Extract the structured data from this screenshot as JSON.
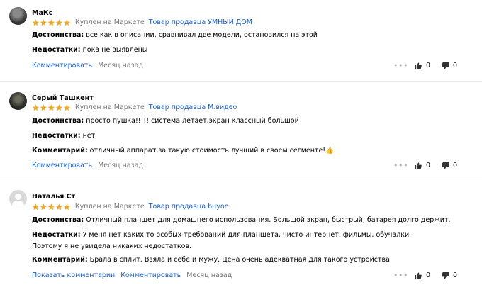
{
  "reviews": [
    {
      "author": "МаКс",
      "bought": "Куплен на Маркете",
      "seller": "Товар продавца УМНЫЙ ДОМ",
      "fields": [
        {
          "label": "Достоинства:",
          "text": "все как в описании, сравнивал две модели, остановился на этой"
        },
        {
          "label": "Недостатки:",
          "text": "пока не выявлены"
        }
      ],
      "comment_link": "Комментировать",
      "date": "Месяц назад",
      "likes": "0",
      "dislikes": "0"
    },
    {
      "author": "Серый Ташкент",
      "bought": "Куплен на Маркете",
      "seller": "Товар продавца М.видео",
      "fields": [
        {
          "label": "Достоинства:",
          "text": "просто пушка!!!!! система летает,экран классный большой"
        },
        {
          "label": "Недостатки:",
          "text": "нет"
        },
        {
          "label": "Комментарий:",
          "text": "отличный аппарат,за такую стоимость лучший в своем сегменте!👍"
        }
      ],
      "comment_link": "Комментировать",
      "date": "Месяц назад",
      "likes": "0",
      "dislikes": "0"
    },
    {
      "author": "Наталья Ст",
      "bought": "Куплен на Маркете",
      "seller": "Товар продавца buyon",
      "fields": [
        {
          "label": "Достоинства:",
          "text": "Отличный планшет для домашнего использования. Большой экран, быстрый, батарея долго держит."
        },
        {
          "label": "Недостатки:",
          "text": "У меня нет каких то особых требований для планшета, чисто интернет, фильмы, обучалки. Поэтому я не увидела никаких недостатков."
        },
        {
          "label": "Комментарий:",
          "text": "Брала в сплит. Взяла и себе и мужу. Цена очень адекватная для такого устройства."
        }
      ],
      "show_comments_link": "Показать комментарии",
      "comment_link": "Комментировать",
      "date": "Месяц назад",
      "likes": "0",
      "dislikes": "0"
    }
  ],
  "colors": {
    "star": "#f5a623",
    "link": "#1a5bd6",
    "muted": "#777777"
  },
  "icons": {
    "more": "more-dots-icon",
    "like": "thumbs-up-icon",
    "dislike": "thumbs-down-icon",
    "star": "star-icon"
  }
}
